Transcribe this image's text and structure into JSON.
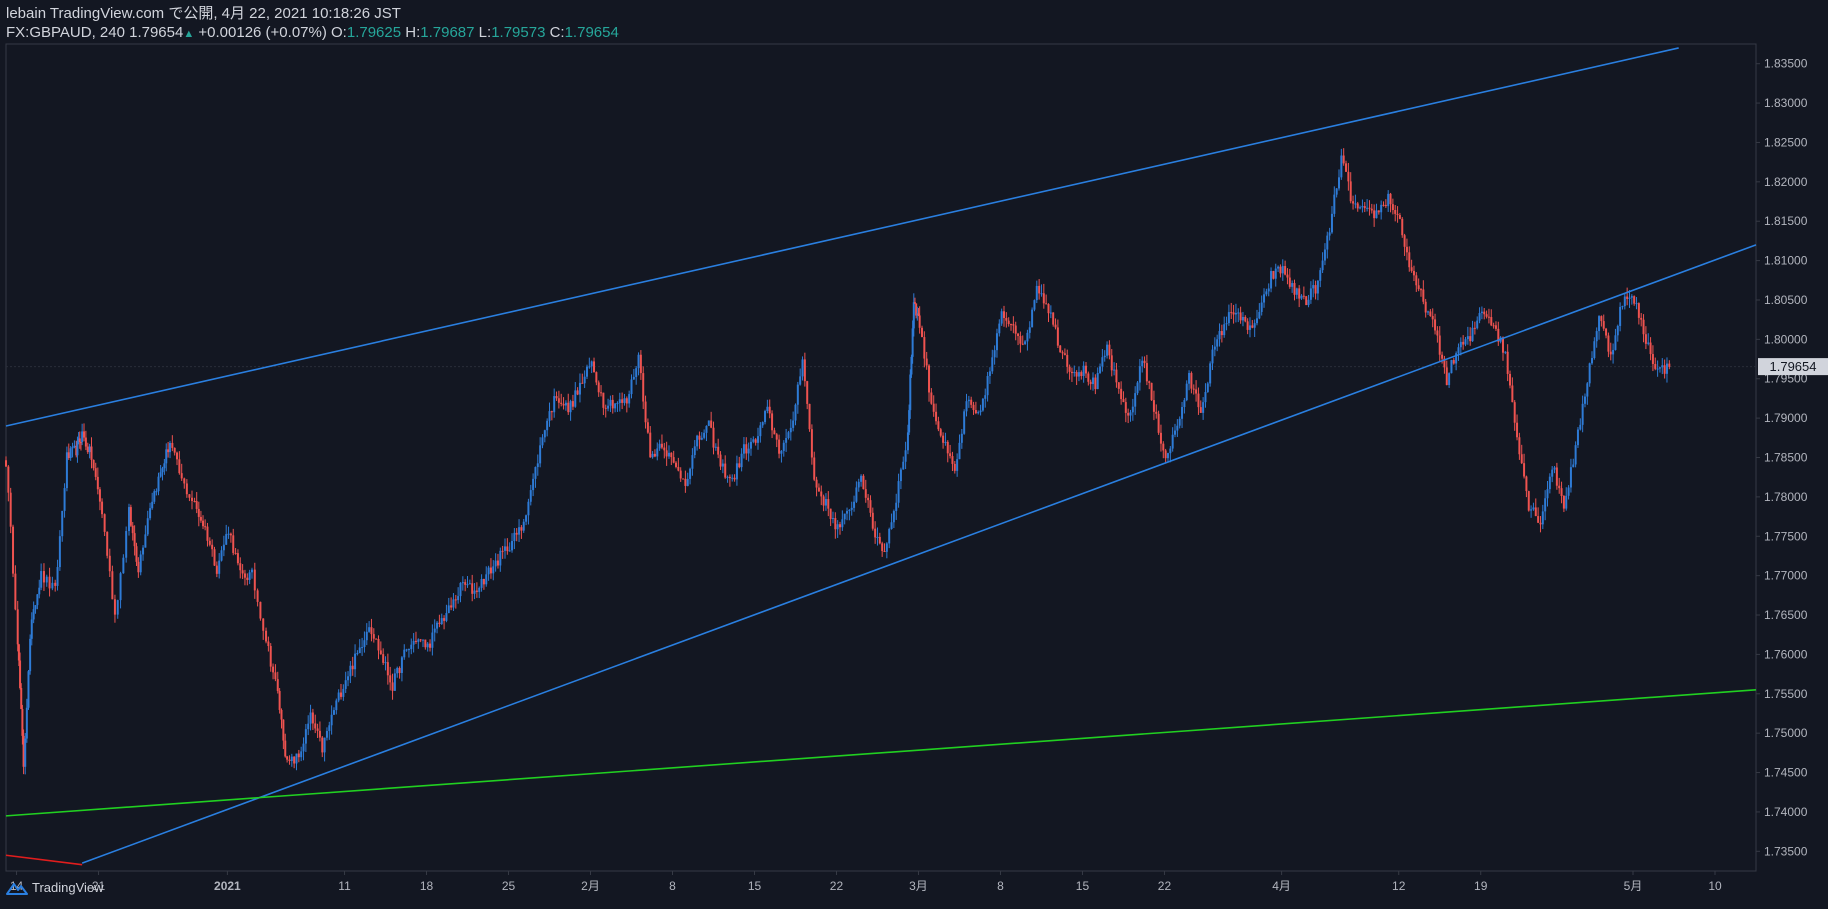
{
  "header": {
    "publish_line": "lebain TradingView.com で公開, 4月 22, 2021 10:18:26 JST",
    "symbol": "FX:GBPAUD, 240",
    "last": "1.79654",
    "change": "+0.00126 (+0.07%)",
    "o_label": "O:",
    "o": "1.79625",
    "h_label": "H:",
    "h": "1.79687",
    "l_label": "L:",
    "l": "1.79573",
    "c_label": "C:",
    "c": "1.79654"
  },
  "footer": {
    "brand": "TradingView"
  },
  "colors": {
    "background": "#131722",
    "up_candle": "#2e7bd6",
    "down_candle": "#ef5350",
    "channel_line": "#2a7fe0",
    "support_line": "#21d021",
    "red_line": "#e11d1d",
    "axis_text": "#b2b5be",
    "last_price_badge": "#d1d4dc"
  },
  "chart_data": {
    "type": "candlestick",
    "symbol": "FX:GBPAUD",
    "timeframe": "240",
    "ylim": [
      1.7325,
      1.8375
    ],
    "y_ticks": [
      "1.83500",
      "1.83000",
      "1.82500",
      "1.82000",
      "1.81500",
      "1.81000",
      "1.80500",
      "1.80000",
      "1.79500",
      "1.79000",
      "1.78500",
      "1.78000",
      "1.77500",
      "1.77000",
      "1.76500",
      "1.76000",
      "1.75500",
      "1.75000",
      "1.74500",
      "1.74000",
      "1.73500"
    ],
    "x_ticks": [
      {
        "label": "14",
        "x": 0.9
      },
      {
        "label": "21",
        "x": 7.9
      },
      {
        "label": "2021",
        "x": 18.9
      },
      {
        "label": "11",
        "x": 28.9
      },
      {
        "label": "18",
        "x": 35.9
      },
      {
        "label": "25",
        "x": 42.9
      },
      {
        "label": "2月",
        "x": 49.9
      },
      {
        "label": "8",
        "x": 56.9
      },
      {
        "label": "15",
        "x": 63.9
      },
      {
        "label": "22",
        "x": 70.9
      },
      {
        "label": "3月",
        "x": 77.9
      },
      {
        "label": "8",
        "x": 84.9
      },
      {
        "label": "15",
        "x": 91.9
      },
      {
        "label": "22",
        "x": 98.9
      },
      {
        "label": "4月",
        "x": 108.9
      },
      {
        "label": "12",
        "x": 118.9
      },
      {
        "label": "19",
        "x": 125.9
      },
      {
        "label": "5月",
        "x": 138.9
      },
      {
        "label": "10",
        "x": 145.9
      }
    ],
    "x_range": [
      0,
      149.4
    ],
    "last_price": "1.79654",
    "path": [
      [
        0.0,
        1.7845
      ],
      [
        1.0,
        1.762
      ],
      [
        1.5,
        1.746
      ],
      [
        2.2,
        1.765
      ],
      [
        3.0,
        1.77
      ],
      [
        4.2,
        1.768
      ],
      [
        5.2,
        1.785
      ],
      [
        6.0,
        1.786
      ],
      [
        6.5,
        1.788
      ],
      [
        7.3,
        1.785
      ],
      [
        8.2,
        1.778
      ],
      [
        9.3,
        1.765
      ],
      [
        10.5,
        1.778
      ],
      [
        11.3,
        1.771
      ],
      [
        12.3,
        1.779
      ],
      [
        13.2,
        1.783
      ],
      [
        14.0,
        1.787
      ],
      [
        15.0,
        1.782
      ],
      [
        16.1,
        1.779
      ],
      [
        17.0,
        1.776
      ],
      [
        18.0,
        1.771
      ],
      [
        19.0,
        1.776
      ],
      [
        20.0,
        1.77
      ],
      [
        21.0,
        1.77
      ],
      [
        22.2,
        1.762
      ],
      [
        23.2,
        1.755
      ],
      [
        24.0,
        1.746
      ],
      [
        25.0,
        1.747
      ],
      [
        26.0,
        1.752
      ],
      [
        27.0,
        1.748
      ],
      [
        28.0,
        1.753
      ],
      [
        29.0,
        1.757
      ],
      [
        30.0,
        1.76
      ],
      [
        31.0,
        1.764
      ],
      [
        32.0,
        1.76
      ],
      [
        33.0,
        1.756
      ],
      [
        34.0,
        1.76
      ],
      [
        35.0,
        1.762
      ],
      [
        36.0,
        1.761
      ],
      [
        37.0,
        1.764
      ],
      [
        38.0,
        1.766
      ],
      [
        39.0,
        1.769
      ],
      [
        40.0,
        1.768
      ],
      [
        41.0,
        1.77
      ],
      [
        42.0,
        1.772
      ],
      [
        43.0,
        1.774
      ],
      [
        44.0,
        1.776
      ],
      [
        45.0,
        1.782
      ],
      [
        46.0,
        1.789
      ],
      [
        47.0,
        1.793
      ],
      [
        48.0,
        1.791
      ],
      [
        49.0,
        1.794
      ],
      [
        50.0,
        1.797
      ],
      [
        51.0,
        1.792
      ],
      [
        52.0,
        1.792
      ],
      [
        53.0,
        1.792
      ],
      [
        54.0,
        1.798
      ],
      [
        55.0,
        1.785
      ],
      [
        56.0,
        1.787
      ],
      [
        57.0,
        1.784
      ],
      [
        58.0,
        1.782
      ],
      [
        59.0,
        1.787
      ],
      [
        60.0,
        1.789
      ],
      [
        61.0,
        1.784
      ],
      [
        62.0,
        1.782
      ],
      [
        63.0,
        1.786
      ],
      [
        64.0,
        1.787
      ],
      [
        65.0,
        1.791
      ],
      [
        66.0,
        1.786
      ],
      [
        67.0,
        1.788
      ],
      [
        68.0,
        1.798
      ],
      [
        69.0,
        1.782
      ],
      [
        70.0,
        1.779
      ],
      [
        71.0,
        1.776
      ],
      [
        72.0,
        1.778
      ],
      [
        73.0,
        1.783
      ],
      [
        74.0,
        1.776
      ],
      [
        75.0,
        1.773
      ],
      [
        76.0,
        1.78
      ],
      [
        77.0,
        1.788
      ],
      [
        77.5,
        1.805
      ],
      [
        78.0,
        1.802
      ],
      [
        79.0,
        1.792
      ],
      [
        80.0,
        1.787
      ],
      [
        81.0,
        1.783
      ],
      [
        82.0,
        1.792
      ],
      [
        83.0,
        1.79
      ],
      [
        84.0,
        1.796
      ],
      [
        85.0,
        1.803
      ],
      [
        86.0,
        1.802
      ],
      [
        87.0,
        1.799
      ],
      [
        88.0,
        1.807
      ],
      [
        89.0,
        1.804
      ],
      [
        90.0,
        1.799
      ],
      [
        91.0,
        1.796
      ],
      [
        92.0,
        1.796
      ],
      [
        93.0,
        1.794
      ],
      [
        94.0,
        1.799
      ],
      [
        95.0,
        1.793
      ],
      [
        96.0,
        1.79
      ],
      [
        97.0,
        1.798
      ],
      [
        98.0,
        1.791
      ],
      [
        99.0,
        1.785
      ],
      [
        100.0,
        1.789
      ],
      [
        101.0,
        1.795
      ],
      [
        102.0,
        1.791
      ],
      [
        103.0,
        1.798
      ],
      [
        104.0,
        1.802
      ],
      [
        105.0,
        1.804
      ],
      [
        106.0,
        1.801
      ],
      [
        107.0,
        1.803
      ],
      [
        108.0,
        1.808
      ],
      [
        109.0,
        1.809
      ],
      [
        110.0,
        1.806
      ],
      [
        111.0,
        1.805
      ],
      [
        112.0,
        1.807
      ],
      [
        113.0,
        1.814
      ],
      [
        114.0,
        1.823
      ],
      [
        115.0,
        1.817
      ],
      [
        116.0,
        1.816
      ],
      [
        117.0,
        1.816
      ],
      [
        118.0,
        1.818
      ],
      [
        119.0,
        1.815
      ],
      [
        120.0,
        1.808
      ],
      [
        121.0,
        1.805
      ],
      [
        122.0,
        1.801
      ],
      [
        123.0,
        1.795
      ],
      [
        124.0,
        1.799
      ],
      [
        125.0,
        1.8
      ],
      [
        126.0,
        1.804
      ],
      [
        127.0,
        1.802
      ],
      [
        128.0,
        1.798
      ],
      [
        129.0,
        1.788
      ],
      [
        130.0,
        1.779
      ],
      [
        131.0,
        1.777
      ],
      [
        132.0,
        1.784
      ],
      [
        133.0,
        1.779
      ],
      [
        134.0,
        1.786
      ],
      [
        135.0,
        1.795
      ],
      [
        136.0,
        1.803
      ],
      [
        137.0,
        1.798
      ],
      [
        138.0,
        1.805
      ],
      [
        139.0,
        1.805
      ],
      [
        140.0,
        1.8
      ],
      [
        141.0,
        1.796
      ],
      [
        142.0,
        1.7965
      ]
    ],
    "trend_lines": [
      {
        "role": "channel-upper",
        "color": "#2a7fe0",
        "from": [
          0.0,
          1.789
        ],
        "to": [
          142.8,
          1.837
        ]
      },
      {
        "role": "channel-lower",
        "color": "#2a7fe0",
        "from": [
          6.5,
          1.7335
        ],
        "to": [
          149.4,
          1.812
        ]
      },
      {
        "role": "support",
        "color": "#21d021",
        "from": [
          0.0,
          1.7395
        ],
        "to": [
          149.4,
          1.7555
        ]
      },
      {
        "role": "red",
        "color": "#e11d1d",
        "from": [
          0.0,
          1.7345
        ],
        "to": [
          6.5,
          1.7333
        ]
      }
    ]
  }
}
